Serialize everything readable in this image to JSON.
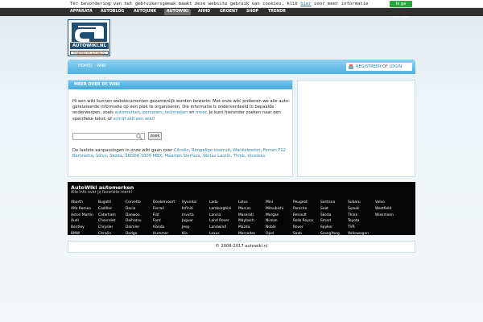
{
  "cookie": {
    "text_before": "Ter bevordering van het gebruikersgemak maakt deze website gebruik van cookies, klik ",
    "link": "hier",
    "text_after": " voor meer informatie",
    "accept_label": "Ik ga akkoord, niet meer"
  },
  "topnav": [
    "APPARATA",
    "AUTOBLOG",
    "AUTOJUNK",
    "AUTOWIKI",
    "AIIHD",
    "GROEN7",
    "SHOP",
    "TRENDR"
  ],
  "logo": {
    "name": "AUTOWIKI.NL",
    "powered": "POWERED BY AUTOBLOG"
  },
  "breadcrumb": {
    "home": "HOME",
    "wiki": "WIKI"
  },
  "account": {
    "register": "REGISTREER",
    "or": "OF",
    "login": "LOGIN"
  },
  "panel": {
    "title": "MEER OVER DE WIKI",
    "intro_1": "Hi een wiki kunnen webdocumenten gezamenlijk worden bewerkt. Met onze wiki proberen we alle auto-gerelateerde informatie op één plek te organiseren. Die informatie is onderverdeeld in bepaalde onderwerpen, zoals ",
    "link_autos": "automerken",
    "sep1": ", ",
    "link_personen": "personen",
    "sep2": ", ",
    "link_technieken": "technieken",
    "sep3": " en ",
    "link_meer": "meer",
    "intro_2": ". Je kunt hieronder zoeken naar een specifieke tekst, of ",
    "link_write": "schrijf zelf een wiki",
    "intro_3": "!",
    "search_button": "zoek",
    "recent_prefix": "De laatste aanpassingen in onze wiki gaan over ",
    "recent_links": [
      "Citroën",
      "Rimpelige voorruit",
      "Wankelmotor",
      "Ferrari F12 Berlinetta",
      "Volvo",
      "Skoda",
      "ŠKODA 1000 MBX",
      "Maarten Sierhuis",
      "Václav Laurin",
      "Think"
    ],
    "recent_suffix": "etcetera"
  },
  "brands": {
    "title": "AutoWiki automerken",
    "subtitle": "Alle info over je favoriete merk!",
    "columns": [
      [
        "Abarth",
        "Alfa Romeo",
        "Aston Martin",
        "Audi",
        "Bentley",
        "BMW"
      ],
      [
        "Bugatti",
        "Cadillac",
        "Caterham",
        "Chevrolet",
        "Chrysler",
        "Citroën"
      ],
      [
        "Corvette",
        "Dacia",
        "Daewoo",
        "Daihatsu",
        "Daimler",
        "Dodge"
      ],
      [
        "Donkervoort",
        "Ferrari",
        "Fiat",
        "Ford",
        "Honda",
        "Hummer"
      ],
      [
        "Hyundai",
        "Infiniti",
        "Invicta",
        "Jaguar",
        "Jeep",
        "Kia"
      ],
      [
        "Lada",
        "Lamborghini",
        "Lancia",
        "Land Rover",
        "Landwind",
        "Lexus"
      ],
      [
        "Lotus",
        "Marcos",
        "Maserati",
        "Maybach",
        "Mazda",
        "Mercedes"
      ],
      [
        "Mini",
        "Mitsubishi",
        "Morgan",
        "Nissan",
        "Noble",
        "Opel"
      ],
      [
        "Peugeot",
        "Porsche",
        "Renault",
        "Rolls Royce",
        "Rover",
        "Saab"
      ],
      [
        "Santana",
        "Seat",
        "Skoda",
        "Smart",
        "Spyker",
        "SsangYong"
      ],
      [
        "Subaru",
        "Suzuki",
        "Think",
        "Toyota",
        "TVR",
        "Volkswagen"
      ],
      [
        "Volvo",
        "Westfield",
        "Wiesmann"
      ]
    ]
  },
  "footer": "© 2008-2017 autowiki.nl"
}
